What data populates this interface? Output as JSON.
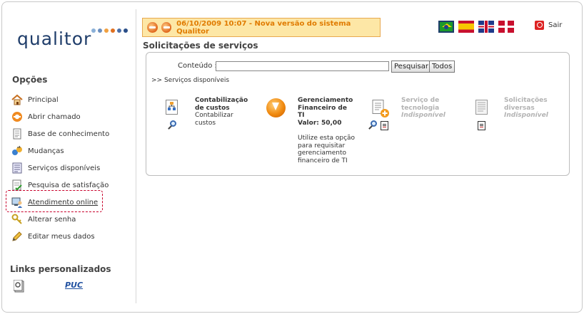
{
  "brand": {
    "logo_text": "qualitor",
    "dot_colors": [
      "#8ab0d8",
      "#6a8fc0",
      "#f0a040",
      "#e07020",
      "#4a6ea8",
      "#2a4e88"
    ]
  },
  "sidebar": {
    "options_title": "Opções",
    "items": [
      {
        "label": "Principal",
        "icon": "home-icon"
      },
      {
        "label": "Abrir chamado",
        "icon": "lifebuoy-icon"
      },
      {
        "label": "Base de conhecimento",
        "icon": "document-icon"
      },
      {
        "label": "Mudanças",
        "icon": "change-icon"
      },
      {
        "label": "Serviços disponíveis",
        "icon": "list-icon"
      },
      {
        "label": "Pesquisa de satisfação",
        "icon": "survey-icon"
      },
      {
        "label": "Atendimento online",
        "icon": "monitor-user-icon",
        "highlighted": true
      },
      {
        "label": "Alterar senha",
        "icon": "key-icon"
      },
      {
        "label": "Editar meus dados",
        "icon": "pencil-icon"
      }
    ],
    "links_title": "Links personalizados",
    "puc_link": "PUC",
    "highlight_color": "#c8002a"
  },
  "banner": {
    "text": "06/10/2009 10:07 - Nova versão do sistema Qualitor"
  },
  "header": {
    "languages": [
      "Português",
      "Español",
      "English",
      "Euskara"
    ],
    "logout_label": "Sair"
  },
  "main": {
    "title": "Solicitações de serviços",
    "search": {
      "label": "Conteúdo :",
      "value": "",
      "search_button": "Pesquisar",
      "all_button": "Todos"
    },
    "available_label": ">> Serviços disponíveis",
    "services": [
      {
        "title_lines": [
          "Contabilização",
          "de custos"
        ],
        "desc_lines": [
          "Contabilizar",
          "custos"
        ]
      },
      {
        "title_lines": [
          "Gerenciamento",
          "Financeiro de",
          "TI",
          "Valor: 50,00"
        ],
        "desc_lines": [
          "Utilize esta opção",
          "para requisitar",
          "gerenciamento",
          "financeiro de TI"
        ]
      },
      {
        "title_lines": [
          "Serviço de",
          "tecnologia"
        ],
        "status": "Indisponível"
      },
      {
        "title_lines": [
          "Solicitações",
          "diversas"
        ],
        "status": "Indisponível"
      }
    ]
  }
}
